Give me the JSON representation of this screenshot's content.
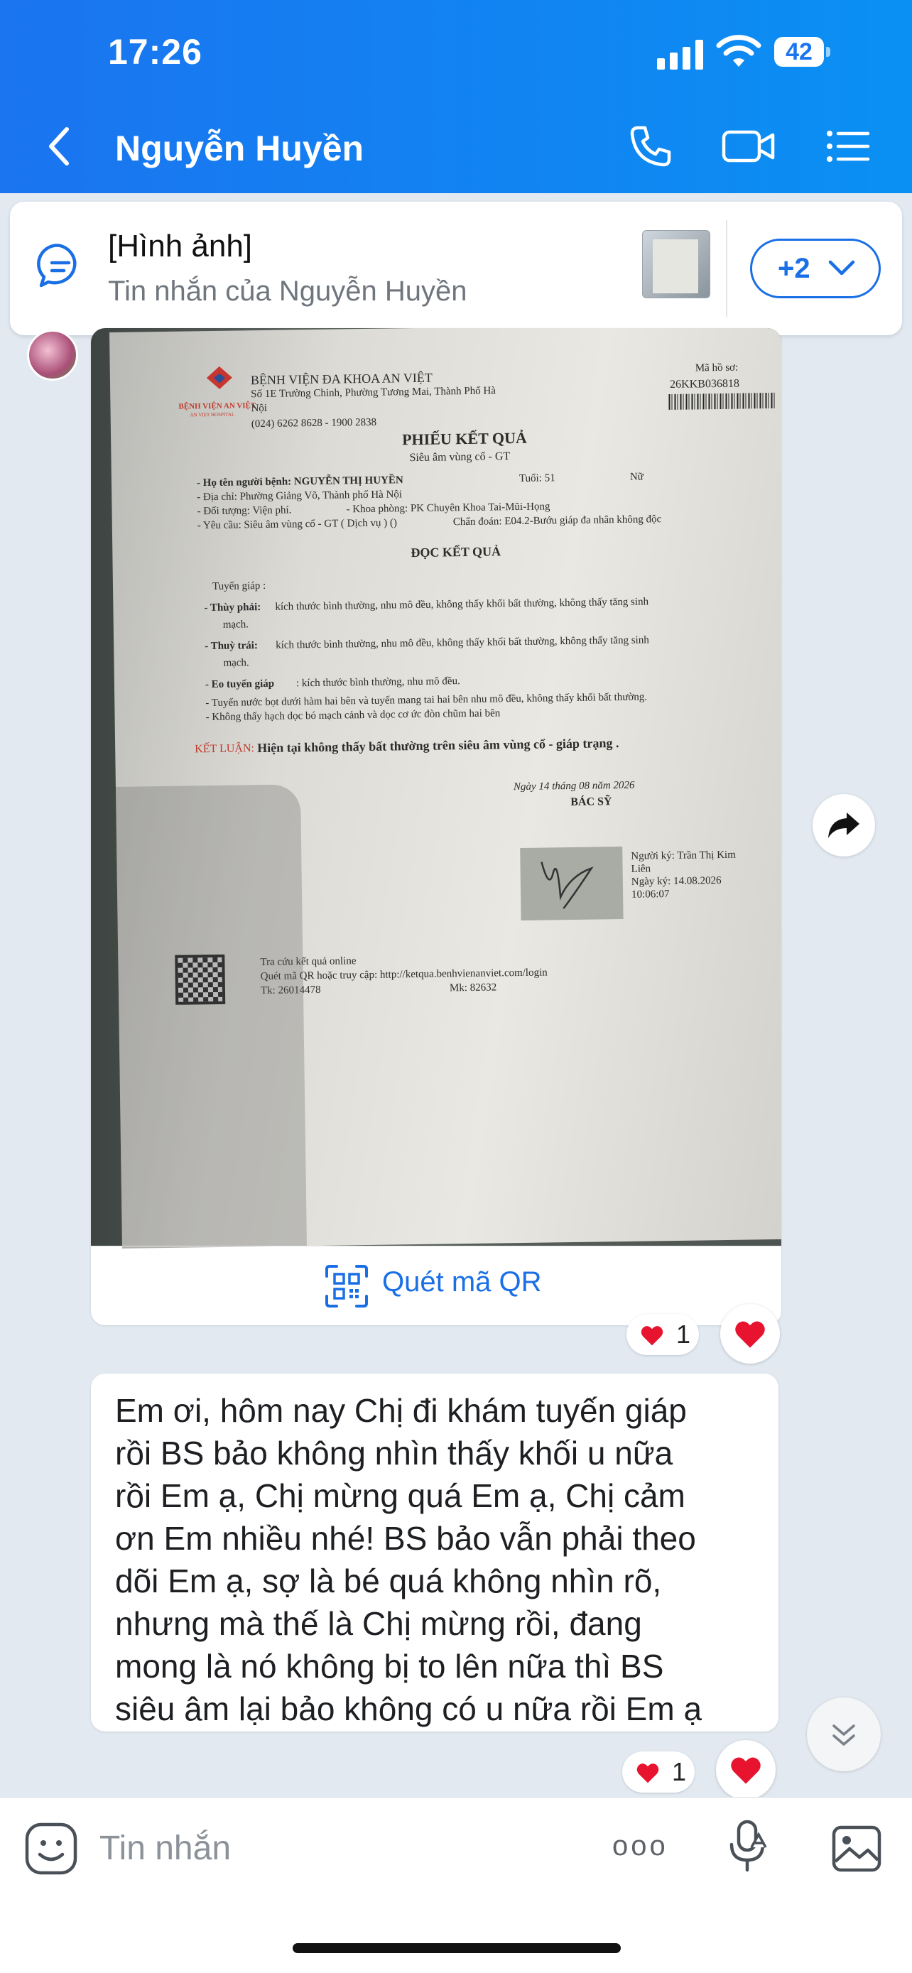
{
  "status_bar": {
    "time": "17:26",
    "battery": "42"
  },
  "header": {
    "title": "Nguyễn Huyền",
    "back_icon": "chevron-left-icon",
    "call_icon": "phone-icon",
    "video_icon": "video-icon",
    "menu_icon": "list-menu-icon"
  },
  "pinned": {
    "title": "[Hình ảnh]",
    "subtitle": "Tin nhắn của Nguyễn Huyền",
    "more_label": "+2"
  },
  "document": {
    "hospital": "BỆNH VIỆN ĐA KHOA AN VIỆT",
    "address1": "Số 1E Trường Chinh, Phường Tương Mai, Thành Phố Hà",
    "address2": "Nội",
    "phone": "(024) 6262 8628 - 1900 2838",
    "logo_text": "BỆNH VIỆN AN VIỆT",
    "logo_sub": "AN VIET HOSPITAL",
    "code_label": "Mã hồ sơ:",
    "code": "26KKB036818",
    "title": "PHIẾU KẾT QUẢ",
    "subtitle": "Siêu âm vùng cổ - GT",
    "patient": "- Họ tên người bệnh: NGUYỄN THỊ HUYỀN",
    "age": "Tuổi: 51",
    "sex": "Nữ",
    "addr": "- Địa chỉ: Phường Giảng Võ, Thành phố Hà Nội",
    "object": "- Đối tượng: Viện phí.",
    "dept": "- Khoa phòng: PK Chuyên Khoa Tai-Mũi-Họng",
    "request": "- Yêu cầu: Siêu âm vùng cổ - GT ( Dịch vụ ) ()",
    "diagnosis": "Chẩn đoán: E04.2-Bướu giáp đa nhân không độc",
    "read_title": "ĐỌC KẾT QUẢ",
    "thyroid": "Tuyến giáp :",
    "right_b": "- Thùy phải:",
    "right_t": "kích thước bình thường, nhu mô đều, không thấy khối bất thường, không thấy tăng sinh",
    "right_t2": "mạch.",
    "left_b": "- Thuỳ trái:",
    "left_t": "kích thước bình thường, nhu mô đều, không thấy khối bất thường, không thấy tăng sinh",
    "left_t2": "mạch.",
    "isthmus_b": "- Eo tuyến giáp",
    "isthmus_t": ": kích thước bình thường, nhu mô đều.",
    "saliva": "- Tuyến nước bọt dưới hàm hai bên và tuyến mang tai hai bên nhu mô đều, không thấy khối bất thường.",
    "lymph": "- Không thấy hạch dọc bó mạch cảnh và dọc cơ ức đòn chũm hai bên",
    "conclusion_label": "KẾT LUẬN:",
    "conclusion": "Hiện tại không thấy bất thường trên siêu âm vùng cổ - giáp trạng .",
    "date": "Ngày 14 tháng 08 năm 2026",
    "doctor": "BÁC SỸ",
    "signer1": "Người ký: Trần Thị Kim",
    "signer2": "Liên",
    "sign_date": "Ngày ký: 14.08.2026",
    "sign_time": "10:06:07",
    "lookup1": "Tra cứu kết quả online",
    "lookup2": "Quét mã QR hoặc truy cập: http://ketqua.benhvienanviet.com/login",
    "tk": "Tk: 26014478",
    "mk": "Mk: 82632"
  },
  "qr_action": {
    "label": "Quét mã QR",
    "icon": "qr-scan-icon"
  },
  "reactions": [
    {
      "emoji": "heart",
      "count": "1"
    },
    {
      "emoji": "heart",
      "count": "1"
    }
  ],
  "message": {
    "lines": [
      "Em ơi, hôm nay Chị đi khám tuyến giáp",
      "rồi BS bảo không nhìn thấy khối u nữa",
      "rồi Em ạ, Chị mừng quá Em ạ, Chị cảm",
      "ơn Em nhiều nhé! BS bảo vẫn phải theo",
      "dõi Em ạ, sợ là bé quá không nhìn rõ,",
      "nhưng mà thế là Chị mừng rồi, đang",
      "mong là nó không bị to lên nữa thì BS",
      "siêu âm lại bảo không có u nữa rồi Em ạ"
    ]
  },
  "composer": {
    "placeholder": "Tin nhắn",
    "more": "ooo"
  },
  "colors": {
    "header_start": "#1b74f0",
    "header_end": "#0a90f3",
    "accent": "#1a6fe6",
    "heart": "#e8132f",
    "chat_bg": "#e2e9f1"
  }
}
